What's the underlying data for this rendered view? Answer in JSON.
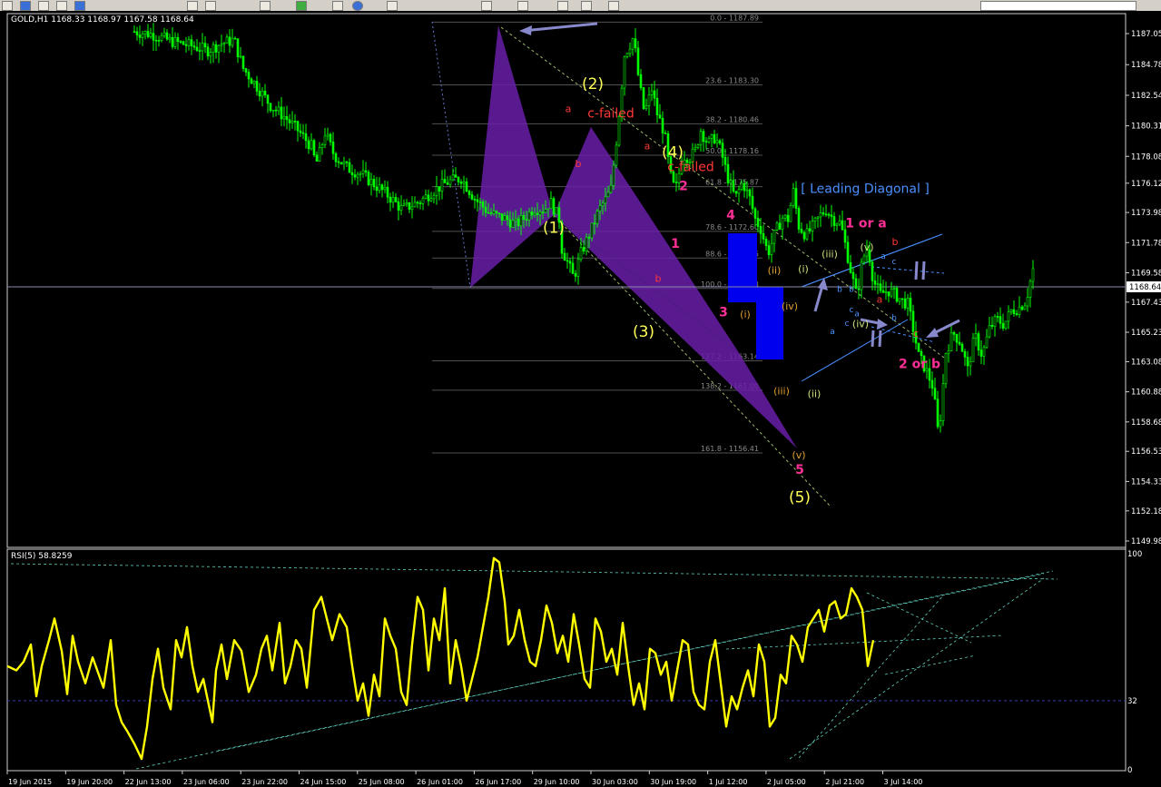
{
  "window": {
    "symbol_header": "GOLD,H1  1168.33 1168.97 1167.58 1168.64",
    "last_price": "1168.64"
  },
  "colors": {
    "background": "#000000",
    "candles": "#00ff00",
    "rsi_line": "#ffff00",
    "purple_pattern": "#6a1fa8",
    "blue_box": "#0000ee",
    "fib_lines": "#555555",
    "trend_lines": "#7fffd4",
    "wave_yellow": "#ffff66",
    "wave_magenta": "#ff3399",
    "wave_red": "#ff3333",
    "wave_blue": "#4a90ff",
    "wave_green": "#bfe070"
  },
  "chart_data": [
    {
      "type": "line",
      "title": "GOLD,H1  1168.33 1168.97 1167.58 1168.64",
      "series_style": "candlestick",
      "ylim": [
        1149.9,
        1188.5
      ],
      "y_ticks": [
        1187.05,
        1184.78,
        1182.54,
        1180.31,
        1178.08,
        1176.12,
        1173.98,
        1171.78,
        1169.58,
        1167.43,
        1165.23,
        1163.08,
        1160.88,
        1158.68,
        1156.53,
        1154.33,
        1152.18,
        1149.98
      ],
      "x_ticks": [
        "19 Jun 2015",
        "19 Jun 20:00",
        "22 Jun 13:00",
        "23 Jun 06:00",
        "23 Jun 22:00",
        "24 Jun 15:00",
        "25 Jun 08:00",
        "26 Jun 01:00",
        "26 Jun 17:00",
        "29 Jun 10:00",
        "30 Jun 03:00",
        "30 Jun 19:00",
        "1 Jul 12:00",
        "2 Jul 05:00",
        "2 Jul 21:00",
        "3 Jul 14:00"
      ],
      "close_path_x": [
        0,
        20,
        40,
        60,
        72,
        80,
        95,
        110,
        115,
        120,
        135,
        150,
        165,
        180,
        195,
        200,
        205,
        210,
        220,
        235,
        250,
        265,
        280,
        295,
        315,
        330,
        345,
        360,
        375,
        390,
        400,
        410,
        420,
        430,
        440,
        452,
        458,
        468,
        470,
        478,
        484,
        492,
        504,
        512,
        520,
        525,
        532,
        540,
        550,
        556,
        562,
        570,
        576,
        584,
        590,
        596,
        604,
        612,
        618,
        624,
        632,
        640,
        646,
        654,
        662,
        670,
        678,
        684,
        690,
        698,
        706,
        714,
        720,
        726,
        732,
        740,
        748,
        756,
        762,
        770,
        778,
        782,
        790,
        796,
        802,
        808,
        814,
        822,
        830,
        838,
        846,
        852,
        858,
        864,
        872,
        880,
        886,
        894,
        902,
        910,
        918,
        926,
        934,
        942,
        950,
        958,
        966,
        974,
        982,
        990
      ],
      "close_path_y": [
        1187.2,
        1187.0,
        1186.5,
        1186.2,
        1186.0,
        1185.8,
        1186.3,
        1186.6,
        1185.5,
        1184.5,
        1183.2,
        1181.8,
        1181.0,
        1180.0,
        1178.8,
        1177.5,
        1178.5,
        1179.8,
        1178.2,
        1177.2,
        1176.8,
        1176.0,
        1175.2,
        1174.2,
        1174.8,
        1175.6,
        1176.2,
        1176.5,
        1175.0,
        1174.0,
        1173.7,
        1173.5,
        1173.1,
        1173.6,
        1174.3,
        1174.2,
        1174.8,
        1173.5,
        1171.5,
        1170.2,
        1169.2,
        1171.0,
        1172.8,
        1174.2,
        1175.0,
        1175.7,
        1179.8,
        1185.5,
        1186.8,
        1183.5,
        1181.2,
        1183.0,
        1181.2,
        1179.8,
        1176.8,
        1175.5,
        1178.2,
        1178.0,
        1178.5,
        1180.0,
        1179.0,
        1179.5,
        1178.5,
        1176.5,
        1175.0,
        1176.2,
        1175.0,
        1173.5,
        1172.8,
        1171.0,
        1172.5,
        1173.6,
        1173.5,
        1175.5,
        1173.0,
        1172.3,
        1173.0,
        1173.8,
        1174.2,
        1173.5,
        1173.2,
        1172.0,
        1169.5,
        1167.8,
        1170.5,
        1171.5,
        1169.0,
        1168.0,
        1168.3,
        1168.0,
        1167.5,
        1167.3,
        1165.5,
        1163.5,
        1162.5,
        1161.2,
        1157.5,
        1163.8,
        1165.2,
        1164.5,
        1162.5,
        1165.0,
        1163.5,
        1165.5,
        1166.2,
        1165.8,
        1166.8,
        1167.0,
        1167.5,
        1169.8
      ],
      "fib_levels": [
        {
          "label": "0.0 - 1187.89",
          "value": 1187.89
        },
        {
          "label": "23.6 - 1183.30",
          "value": 1183.3
        },
        {
          "label": "38.2 - 1180.46",
          "value": 1180.46
        },
        {
          "label": "50.0 - 1178.16",
          "value": 1178.16
        },
        {
          "label": "61.8 - 1175.87",
          "value": 1175.87
        },
        {
          "label": "78.6 - 1172.60",
          "value": 1172.6
        },
        {
          "label": "88.6 - 1170.65",
          "value": 1170.65
        },
        {
          "label": "100.0 - 1168.43",
          "value": 1168.43
        },
        {
          "label": "127.2 - 1163.14",
          "value": 1163.14
        },
        {
          "label": "138.2 - 1161.00",
          "value": 1161.0
        },
        {
          "label": "161.8 - 1156.41",
          "value": 1156.41
        }
      ],
      "annotations": [
        {
          "text": "(2)",
          "color": "yellow",
          "x": 653,
          "y": 1183.0,
          "size": "large"
        },
        {
          "text": "(4)",
          "color": "yellow",
          "x": 741,
          "y": 1178.0,
          "size": "large"
        },
        {
          "text": "(1)",
          "color": "yellow",
          "x": 610,
          "y": 1172.5,
          "size": "large"
        },
        {
          "text": "(3)",
          "color": "yellow",
          "x": 709,
          "y": 1164.9,
          "size": "large"
        },
        {
          "text": "(5)",
          "color": "yellow",
          "x": 881,
          "y": 1152.8,
          "size": "large"
        },
        {
          "text": "a",
          "color": "red",
          "x": 626,
          "y": 1181.3,
          "size": "small"
        },
        {
          "text": "c-failed",
          "color": "red",
          "x": 673,
          "y": 1180.9,
          "size": "medium"
        },
        {
          "text": "b",
          "color": "red",
          "x": 637,
          "y": 1177.3,
          "size": "small"
        },
        {
          "text": "a",
          "color": "red",
          "x": 713,
          "y": 1178.6,
          "size": "small"
        },
        {
          "text": "c-failed",
          "color": "red",
          "x": 761,
          "y": 1177.0,
          "size": "medium"
        },
        {
          "text": "b",
          "color": "red",
          "x": 725,
          "y": 1168.9,
          "size": "small"
        },
        {
          "text": "2",
          "color": "magenta",
          "x": 753,
          "y": 1175.6,
          "size": "medium"
        },
        {
          "text": "1",
          "color": "magenta",
          "x": 744,
          "y": 1171.4,
          "size": "medium"
        },
        {
          "text": "4",
          "color": "magenta",
          "x": 805,
          "y": 1173.5,
          "size": "medium"
        },
        {
          "text": "3",
          "color": "magenta",
          "x": 797,
          "y": 1166.4,
          "size": "medium"
        },
        {
          "text": "5",
          "color": "magenta",
          "x": 881,
          "y": 1154.9,
          "size": "medium"
        },
        {
          "text": "(i)",
          "color": "orange",
          "x": 821,
          "y": 1166.3,
          "size": "small"
        },
        {
          "text": "(ii)",
          "color": "orange",
          "x": 853,
          "y": 1169.5,
          "size": "small"
        },
        {
          "text": "(iii)",
          "color": "orange",
          "x": 861,
          "y": 1160.7,
          "size": "small"
        },
        {
          "text": "(iv)",
          "color": "orange",
          "x": 870,
          "y": 1166.9,
          "size": "small"
        },
        {
          "text": "(v)",
          "color": "orange",
          "x": 880,
          "y": 1156.0,
          "size": "small"
        },
        {
          "text": "[ Leading Diagonal ]",
          "color": "blue",
          "x": 953,
          "y": 1175.4,
          "size": "medium"
        },
        {
          "text": "1 or a",
          "color": "magenta",
          "x": 954,
          "y": 1172.9,
          "size": "medium"
        },
        {
          "text": "(i)",
          "color": "green",
          "x": 885,
          "y": 1169.6,
          "size": "small"
        },
        {
          "text": "(iii)",
          "color": "green",
          "x": 914,
          "y": 1170.7,
          "size": "small"
        },
        {
          "text": "(v)",
          "color": "green",
          "x": 955,
          "y": 1171.2,
          "size": "small"
        },
        {
          "text": "(ii)",
          "color": "green",
          "x": 897,
          "y": 1160.5,
          "size": "small"
        },
        {
          "text": "(iv)",
          "color": "green",
          "x": 948,
          "y": 1165.6,
          "size": "small"
        },
        {
          "text": "b",
          "color": "red",
          "x": 986,
          "y": 1171.6,
          "size": "small"
        },
        {
          "text": "a",
          "color": "red",
          "x": 969,
          "y": 1167.4,
          "size": "small"
        },
        {
          "text": "c",
          "color": "red",
          "x": 1009,
          "y": 1164.9,
          "size": "small"
        },
        {
          "text": "2 or b",
          "color": "magenta",
          "x": 1013,
          "y": 1162.6,
          "size": "medium"
        },
        {
          "text": "a",
          "color": "blue",
          "x": 917,
          "y": 1165.1,
          "size": "tiny"
        },
        {
          "text": "b",
          "color": "blue",
          "x": 925,
          "y": 1168.2,
          "size": "tiny"
        },
        {
          "text": "c",
          "color": "blue",
          "x": 933,
          "y": 1165.7,
          "size": "tiny"
        },
        {
          "text": "b",
          "color": "blue",
          "x": 938,
          "y": 1168.2,
          "size": "tiny"
        },
        {
          "text": "a",
          "color": "blue",
          "x": 944,
          "y": 1166.4,
          "size": "tiny"
        },
        {
          "text": "c",
          "color": "blue",
          "x": 938,
          "y": 1166.7,
          "size": "tiny"
        },
        {
          "text": "a",
          "color": "blue",
          "x": 973,
          "y": 1170.6,
          "size": "tiny"
        },
        {
          "text": "c",
          "color": "blue",
          "x": 985,
          "y": 1170.2,
          "size": "tiny"
        },
        {
          "text": "b",
          "color": "blue",
          "x": 985,
          "y": 1166.1,
          "size": "tiny"
        }
      ]
    },
    {
      "type": "line",
      "title": "RSI(5) 58.8259",
      "ylim": [
        0,
        100
      ],
      "y_ticks": [
        100,
        32,
        0
      ],
      "levels": [
        32
      ],
      "x": [
        0,
        10,
        18,
        26,
        32,
        38,
        46,
        52,
        60,
        66,
        72,
        78,
        86,
        94,
        100,
        106,
        114,
        120,
        126,
        132,
        140,
        148,
        154,
        160,
        166,
        172,
        180,
        186,
        192,
        198,
        204,
        210,
        216,
        222,
        226,
        230,
        236,
        242,
        250,
        258,
        266,
        274,
        280,
        286,
        292,
        300,
        306,
        312,
        318,
        324,
        330,
        338,
        346,
        352,
        358,
        366,
        374,
        380,
        386,
        392,
        398,
        404,
        410,
        416,
        422,
        428,
        434,
        440,
        446,
        452,
        458,
        464,
        470,
        476,
        482,
        488,
        494,
        500,
        506,
        512,
        518,
        524,
        530,
        536,
        542,
        548,
        552,
        558,
        564,
        570,
        576,
        582,
        588,
        594,
        600,
        606,
        612,
        618,
        624,
        630,
        636,
        642,
        648,
        654,
        660,
        666,
        672,
        678,
        684,
        690,
        696,
        702,
        708,
        714,
        720,
        726,
        732,
        738,
        744,
        750,
        756,
        762,
        768,
        774,
        780,
        786,
        792,
        798,
        804,
        810,
        816,
        822,
        828,
        834,
        840,
        846,
        852,
        858,
        864,
        870,
        876,
        882,
        888,
        894,
        900,
        906,
        912,
        918,
        924,
        930,
        936,
        942,
        948,
        954,
        960,
        966,
        972,
        978,
        984,
        990
      ],
      "values": [
        48,
        46,
        50,
        58,
        34,
        48,
        60,
        70,
        55,
        35,
        62,
        50,
        40,
        52,
        45,
        38,
        60,
        30,
        22,
        18,
        12,
        5,
        20,
        42,
        56,
        38,
        28,
        60,
        52,
        66,
        48,
        36,
        42,
        30,
        22,
        46,
        58,
        42,
        60,
        55,
        36,
        44,
        56,
        62,
        46,
        68,
        40,
        48,
        60,
        56,
        38,
        74,
        80,
        70,
        60,
        72,
        66,
        48,
        32,
        40,
        25,
        44,
        34,
        70,
        62,
        56,
        36,
        30,
        58,
        80,
        74,
        46,
        70,
        60,
        84,
        40,
        60,
        48,
        32,
        42,
        52,
        66,
        80,
        98,
        96,
        78,
        58,
        62,
        74,
        60,
        50,
        48,
        60,
        76,
        68,
        54,
        62,
        50,
        72,
        58,
        42,
        38,
        70,
        64,
        50,
        56,
        44,
        68,
        48,
        30,
        40,
        28,
        56,
        54,
        44,
        50,
        32,
        46,
        60,
        58,
        36,
        30,
        28,
        50,
        60,
        40,
        20,
        34,
        28,
        38,
        46,
        34,
        58,
        50,
        20,
        24,
        44,
        40,
        62,
        58,
        50,
        66,
        70,
        74,
        64,
        76,
        78,
        70,
        72,
        84,
        80,
        74,
        48,
        60
      ],
      "trendlines": "dashed cyan lines converging to the right"
    }
  ]
}
